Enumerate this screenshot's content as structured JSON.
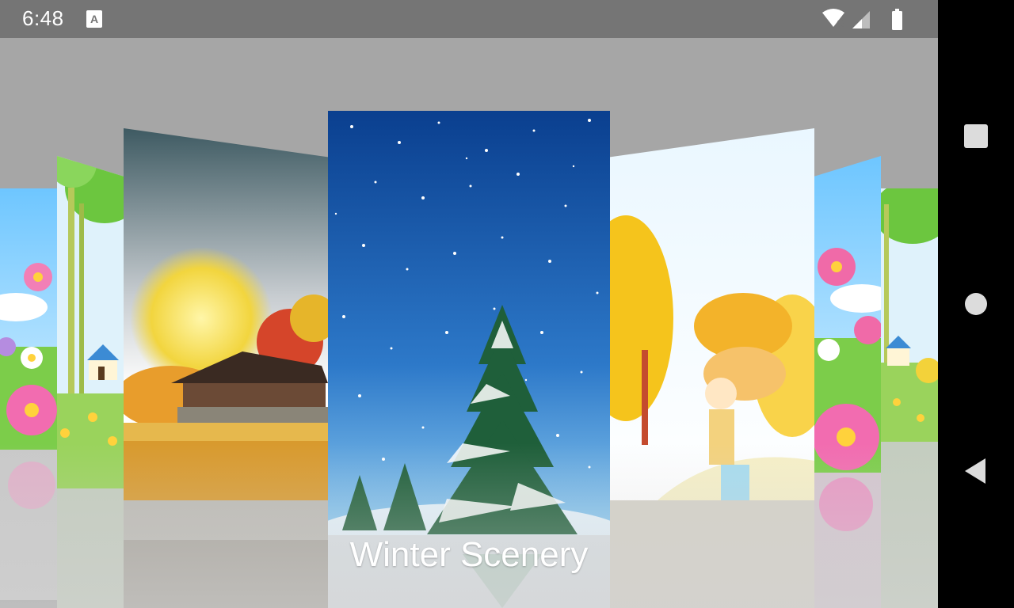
{
  "status_bar": {
    "time": "6:48",
    "notification_icon": "font-app-icon",
    "icons": [
      "wifi-no-internet-icon",
      "signal-icon",
      "battery-full-icon"
    ]
  },
  "gallery": {
    "selected_caption": "Winter Scenery",
    "cards": [
      {
        "name": "flowers-far-left"
      },
      {
        "name": "meadow-house-left"
      },
      {
        "name": "autumn-moon-pagoda"
      },
      {
        "name": "winter-scenery"
      },
      {
        "name": "autumn-girl"
      },
      {
        "name": "flowers-right"
      },
      {
        "name": "meadow-house-right"
      }
    ]
  },
  "nav_bar": {
    "buttons": [
      "recents-button",
      "home-button",
      "back-button"
    ]
  },
  "colors": {
    "status_bar": "#757575",
    "background": "#a6a6a6",
    "nav_bar": "#000000",
    "winter_sky_top": "#0a3f8f",
    "winter_sky_bottom": "#7fc0ef"
  }
}
